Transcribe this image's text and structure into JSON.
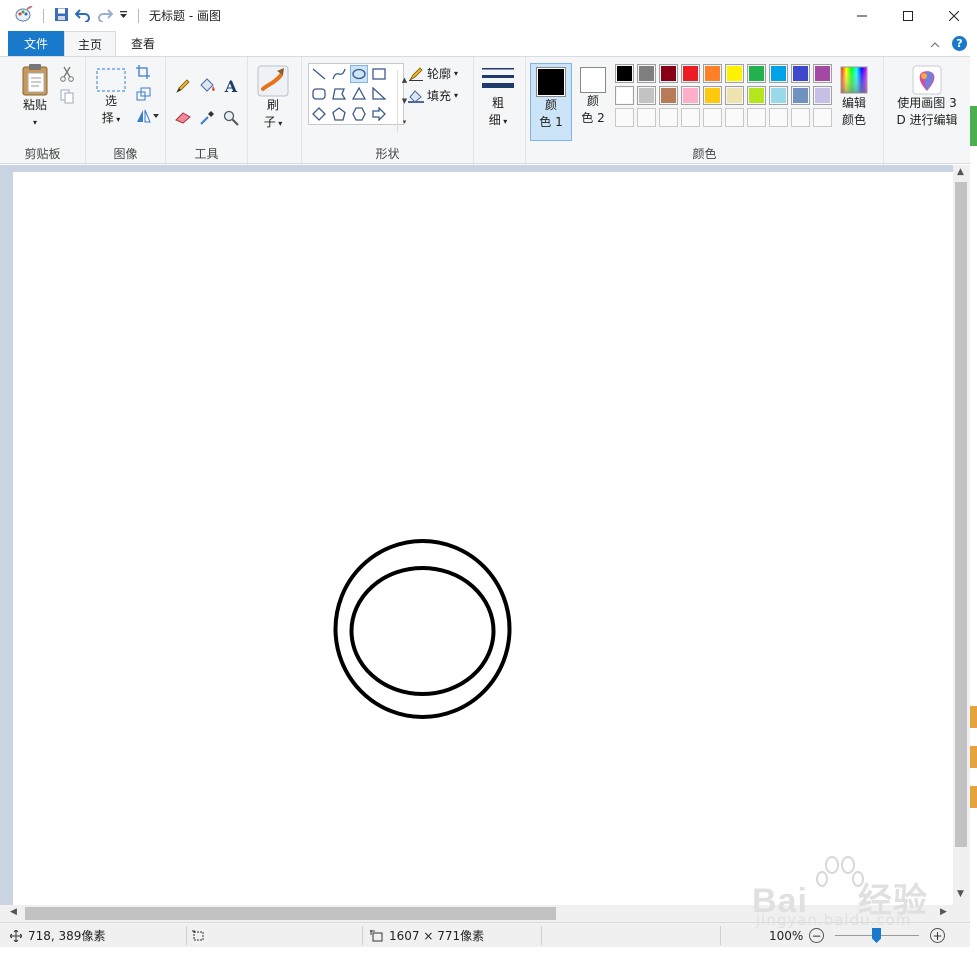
{
  "window": {
    "title": "无标题 - 画图",
    "minimize": "—",
    "maximize": "☐",
    "close": "✕"
  },
  "tabs": [
    {
      "label": "文件"
    },
    {
      "label": "主页"
    },
    {
      "label": "查看"
    }
  ],
  "ribbon": {
    "clipboard": {
      "group_label": "剪贴板",
      "paste_label": "粘贴"
    },
    "image": {
      "group_label": "图像",
      "select_label_1": "选",
      "select_label_2": "择"
    },
    "tools": {
      "group_label": "工具",
      "text_glyph": "A"
    },
    "brush": {
      "label_1": "刷",
      "label_2": "子"
    },
    "shapes": {
      "group_label": "形状",
      "outline_label": "轮廓",
      "fill_label": "填充"
    },
    "size": {
      "label_1": "粗",
      "label_2": "细"
    },
    "colors": {
      "group_label": "颜色",
      "color1_label_1": "颜",
      "color1_label_2": "色 1",
      "color2_label_1": "颜",
      "color2_label_2": "色 2",
      "edit_label_1": "编辑",
      "edit_label_2": "颜色",
      "color1": "#000000",
      "color2": "#ffffff",
      "palette_row1": [
        "#000000",
        "#7f7f7f",
        "#880015",
        "#ed1c24",
        "#ff7f27",
        "#fff200",
        "#22b14c",
        "#00a2e8",
        "#3f48cc",
        "#a349a4"
      ],
      "palette_row2": [
        "#ffffff",
        "#c3c3c3",
        "#b97a57",
        "#ffaec9",
        "#ffc90e",
        "#efe4b0",
        "#b5e61d",
        "#99d9ea",
        "#7092be",
        "#c8bfe7"
      ]
    },
    "paint3d": {
      "label_1": "使用画图 3",
      "label_2": "D 进行编辑"
    }
  },
  "status": {
    "cursor_pos": "718, 389像素",
    "canvas_size": "1607 × 771像素",
    "zoom": "100%"
  },
  "watermark": {
    "brand": "Bai",
    "brand2": "经验",
    "url": "jingyan.baidu.com"
  }
}
